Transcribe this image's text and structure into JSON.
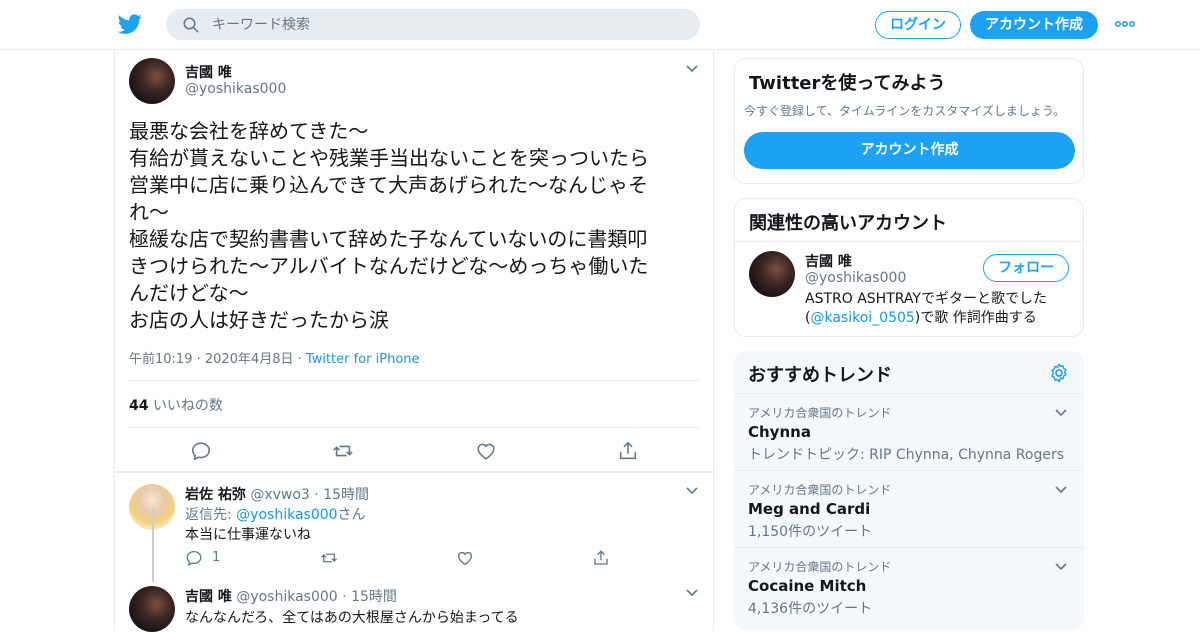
{
  "colors": {
    "accent": "#1da1f2",
    "link": "#1b95e0",
    "muted": "#657786",
    "border": "#e6ecf0"
  },
  "header": {
    "search_placeholder": "キーワード検索",
    "login_label": "ログイン",
    "signup_label": "アカウント作成"
  },
  "tweet": {
    "author_name": "吉國 唯",
    "author_handle": "@yoshikas000",
    "lines": [
      "最悪な会社を辞めてきた〜",
      "有給が貰えないことや残業手当出ないことを突っついたら",
      "営業中に店に乗り込んできて大声あげられた〜なんじゃそ",
      "れ〜",
      "極緩な店で契約書書いて辞めた子なんていないのに書類叩",
      "きつけられた〜アルバイトなんだけどな〜めっちゃ働いた",
      "んだけどな〜",
      "お店の人は好きだったから涙"
    ],
    "time": "午前10:19",
    "date": "2020年4月8日",
    "source": "Twitter for iPhone",
    "likes_count": "44",
    "likes_label": "いいねの数"
  },
  "replies": [
    {
      "name": "岩佐 祐弥",
      "handle": "@xvwo3",
      "time": "15時間",
      "reply_prefix": "返信先:",
      "reply_to": "@yoshikas000",
      "reply_suffix": "さん",
      "text": "本当に仕事運ないね",
      "reply_count": "1"
    },
    {
      "name": "吉國 唯",
      "handle": "@yoshikas000",
      "time": "15時間",
      "text": "なんなんだろ、全てはあの大根屋さんから始まってる"
    }
  ],
  "signup_card": {
    "title": "Twitterを使ってみよう",
    "subtitle": "今すぐ登録して、タイムラインをカスタマイズしましょう。",
    "button": "アカウント作成"
  },
  "related_card": {
    "title": "関連性の高いアカウント",
    "name": "吉國 唯",
    "handle": "@yoshikas000",
    "follow": "フォロー",
    "bio_line1": "ASTRO ASHTRAYでギターと歌でした",
    "bio_open": "(",
    "bio_link": "@kasikoi_0505",
    "bio_rest": ")で歌 作詞作曲する"
  },
  "trends_card": {
    "title": "おすすめトレンド",
    "items": [
      {
        "location": "アメリカ合衆国のトレンド",
        "title": "Chynna",
        "sub": "トレンドトピック: RIP Chynna, Chynna Rogers"
      },
      {
        "location": "アメリカ合衆国のトレンド",
        "title": "Meg and Cardi",
        "sub": "1,150件のツイート"
      },
      {
        "location": "アメリカ合衆国のトレンド",
        "title": "Cocaine Mitch",
        "sub": "4,136件のツイート"
      }
    ]
  }
}
